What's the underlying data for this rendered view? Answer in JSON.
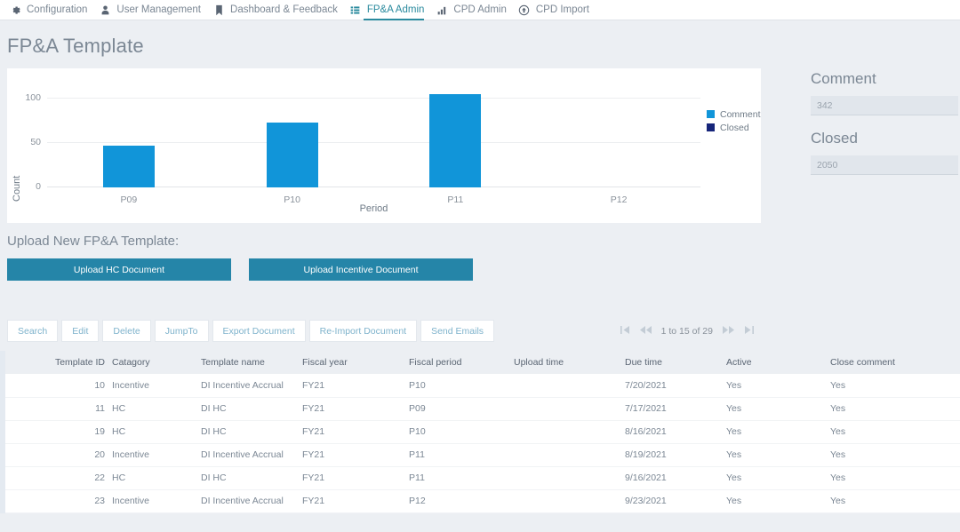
{
  "nav": {
    "items": [
      {
        "label": "Configuration",
        "icon": "gear-icon",
        "active": false
      },
      {
        "label": "User Management",
        "icon": "person-icon",
        "active": false
      },
      {
        "label": "Dashboard & Feedback",
        "icon": "bookmark-icon",
        "active": false
      },
      {
        "label": "FP&A Admin",
        "icon": "list-icon",
        "active": true
      },
      {
        "label": "CPD Admin",
        "icon": "bar-chart-icon",
        "active": false
      },
      {
        "label": "CPD Import",
        "icon": "upload-circle-icon",
        "active": false
      }
    ]
  },
  "page": {
    "title": "FP&A Template"
  },
  "chart_data": {
    "type": "bar",
    "title": "",
    "xlabel": "Period",
    "ylabel": "Count",
    "categories": [
      "P09",
      "P10",
      "P11",
      "P12"
    ],
    "series": [
      {
        "name": "Comment",
        "color": "#1195d9",
        "values": [
          47,
          73,
          105,
          0
        ]
      },
      {
        "name": "Closed",
        "color": "#16257a",
        "values": [
          0,
          0,
          0,
          0
        ]
      }
    ],
    "yticks": [
      0,
      50,
      100
    ],
    "ylim": [
      0,
      120
    ],
    "grid": true,
    "legend_position": "right",
    "legend": [
      "Comment",
      "Closed"
    ]
  },
  "side_panel": {
    "comment": {
      "label": "Comment",
      "value": "342"
    },
    "closed": {
      "label": "Closed",
      "value": "2050"
    }
  },
  "upload": {
    "heading": "Upload New FP&A Template:",
    "hc_button": "Upload HC Document",
    "incentive_button": "Upload Incentive Document"
  },
  "toolbar": {
    "buttons": [
      "Search",
      "Edit",
      "Delete",
      "JumpTo",
      "Export Document",
      "Re-Import Document",
      "Send Emails"
    ]
  },
  "pager": {
    "first": "⏮",
    "prev": "«",
    "text": "1 to 15 of 29",
    "next": "»",
    "last": "⏭"
  },
  "table": {
    "columns": [
      "Template ID",
      "Catagory",
      "Template name",
      "Fiscal year",
      "Fiscal period",
      "Upload time",
      "Due time",
      "Active",
      "Close comment"
    ],
    "rows": [
      {
        "id": "10",
        "category": "Incentive",
        "name": "DI Incentive Accrual",
        "fiscal_year": "FY21",
        "fiscal_period": "P10",
        "upload_time": "",
        "due_time": "7/20/2021",
        "active": "Yes",
        "close_comment": "Yes"
      },
      {
        "id": "11",
        "category": "HC",
        "name": "DI HC",
        "fiscal_year": "FY21",
        "fiscal_period": "P09",
        "upload_time": "",
        "due_time": "7/17/2021",
        "active": "Yes",
        "close_comment": "Yes"
      },
      {
        "id": "19",
        "category": "HC",
        "name": "DI HC",
        "fiscal_year": "FY21",
        "fiscal_period": "P10",
        "upload_time": "",
        "due_time": "8/16/2021",
        "active": "Yes",
        "close_comment": "Yes"
      },
      {
        "id": "20",
        "category": "Incentive",
        "name": "DI Incentive Accrual",
        "fiscal_year": "FY21",
        "fiscal_period": "P11",
        "upload_time": "",
        "due_time": "8/19/2021",
        "active": "Yes",
        "close_comment": "Yes"
      },
      {
        "id": "22",
        "category": "HC",
        "name": "DI HC",
        "fiscal_year": "FY21",
        "fiscal_period": "P11",
        "upload_time": "",
        "due_time": "9/16/2021",
        "active": "Yes",
        "close_comment": "Yes"
      },
      {
        "id": "23",
        "category": "Incentive",
        "name": "DI Incentive Accrual",
        "fiscal_year": "FY21",
        "fiscal_period": "P12",
        "upload_time": "",
        "due_time": "9/23/2021",
        "active": "Yes",
        "close_comment": "Yes"
      }
    ]
  }
}
